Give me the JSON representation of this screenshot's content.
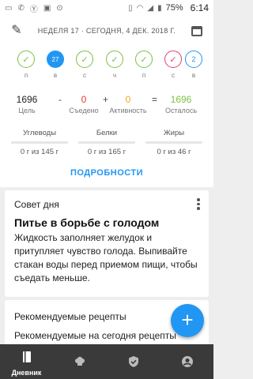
{
  "status_bar": {
    "battery_percent": "75%",
    "time": "6:14"
  },
  "week_header": {
    "label": "НЕДЕЛЯ 17 · СЕГОДНЯ, 4 ДЕК. 2018 Г.",
    "days": [
      {
        "letter": "п",
        "state": "done",
        "mark": "✓"
      },
      {
        "letter": "в",
        "state": "today",
        "mark": "27"
      },
      {
        "letter": "с",
        "state": "done",
        "mark": "✓"
      },
      {
        "letter": "ч",
        "state": "done",
        "mark": "✓"
      },
      {
        "letter": "п",
        "state": "done",
        "mark": "✓"
      },
      {
        "letter": "с",
        "state": "over",
        "mark": "✓"
      },
      {
        "letter": "в",
        "state": "future",
        "mark": "2"
      }
    ]
  },
  "summary": {
    "goal_value": "1696",
    "goal_label": "Цель",
    "minus": "-",
    "eaten_value": "0",
    "eaten_label": "Съедено",
    "plus": "+",
    "activity_value": "0",
    "activity_label": "Активность",
    "equals": "=",
    "remaining_value": "1696",
    "remaining_label": "Осталось",
    "macros": [
      {
        "name": "Углеводы",
        "value": "0 г из 145 г"
      },
      {
        "name": "Белки",
        "value": "0 г из 165 г"
      },
      {
        "name": "Жиры",
        "value": "0 г из 46 г"
      }
    ],
    "details_label": "ПОДРОБНОСТИ"
  },
  "tip": {
    "title": "Совет дня",
    "heading": "Питье в борьбе с голодом",
    "body": "Жидкость заполняет желудок и притупляет чувство голода. Выпивайте стакан воды перед приемом пищи, чтобы съедать меньше."
  },
  "recipes": {
    "title": "Рекомендуемые рецепты",
    "subtitle": "Рекомендуемые на сегодня рецепты"
  },
  "fab_label": "+",
  "bottom_nav": {
    "diary_label": "Дневник"
  },
  "colors": {
    "accent": "#2196f3",
    "done": "#7cc142",
    "over": "#e53c6c",
    "nav_bg": "#3a3a3a"
  }
}
